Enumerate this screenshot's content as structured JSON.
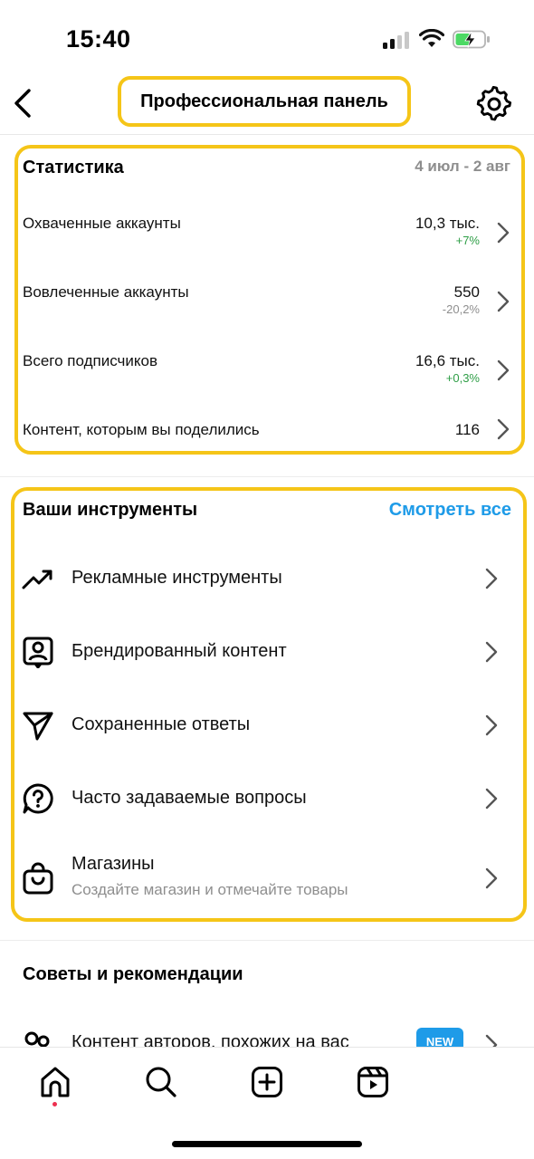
{
  "status_bar": {
    "time": "15:40",
    "icons": [
      "cellular-signal-icon",
      "wifi-icon",
      "battery-charging-icon"
    ],
    "battery_color": "#4cd964"
  },
  "header": {
    "title": "Профессиональная панель",
    "back_icon": "chevron-left-icon",
    "settings_icon": "gear-icon"
  },
  "highlight_color": "#f5c518",
  "stats": {
    "title": "Статистика",
    "date_range": "4 июл - 2 авг",
    "rows": [
      {
        "label": "Охваченные аккаунты",
        "value": "10,3 тыс.",
        "delta": "+7%",
        "delta_color": "#2e9e46"
      },
      {
        "label": "Вовлеченные аккаунты",
        "value": "550",
        "delta": "-20,2%",
        "delta_color": "#8e8e8e"
      },
      {
        "label": "Всего подписчиков",
        "value": "16,6 тыс.",
        "delta": "+0,3%",
        "delta_color": "#2e9e46"
      },
      {
        "label": "Контент, которым вы поделились",
        "value": "116",
        "delta": ""
      }
    ]
  },
  "tools": {
    "title": "Ваши инструменты",
    "see_all": "Смотреть все",
    "accent_color": "#1e9be8",
    "items": [
      {
        "icon": "trending-up-icon",
        "label": "Рекламные инструменты",
        "sub": ""
      },
      {
        "icon": "branded-content-icon",
        "label": "Брендированный контент",
        "sub": ""
      },
      {
        "icon": "paper-plane-icon",
        "label": "Сохраненные ответы",
        "sub": ""
      },
      {
        "icon": "question-bubble-icon",
        "label": "Часто задаваемые вопросы",
        "sub": ""
      },
      {
        "icon": "shopping-bag-icon",
        "label": "Магазины",
        "sub": "Создайте магазин и отмечайте товары"
      }
    ]
  },
  "tips": {
    "title": "Советы и рекомендации",
    "items": [
      {
        "icon": "users-icon",
        "label": "Контент авторов, похожих на вас",
        "badge": "NEW"
      }
    ]
  },
  "bottom_nav": {
    "items": [
      "home-icon",
      "search-icon",
      "add-post-icon",
      "reels-icon"
    ],
    "active": "home-icon",
    "active_dot_color": "#ed2f4f"
  }
}
